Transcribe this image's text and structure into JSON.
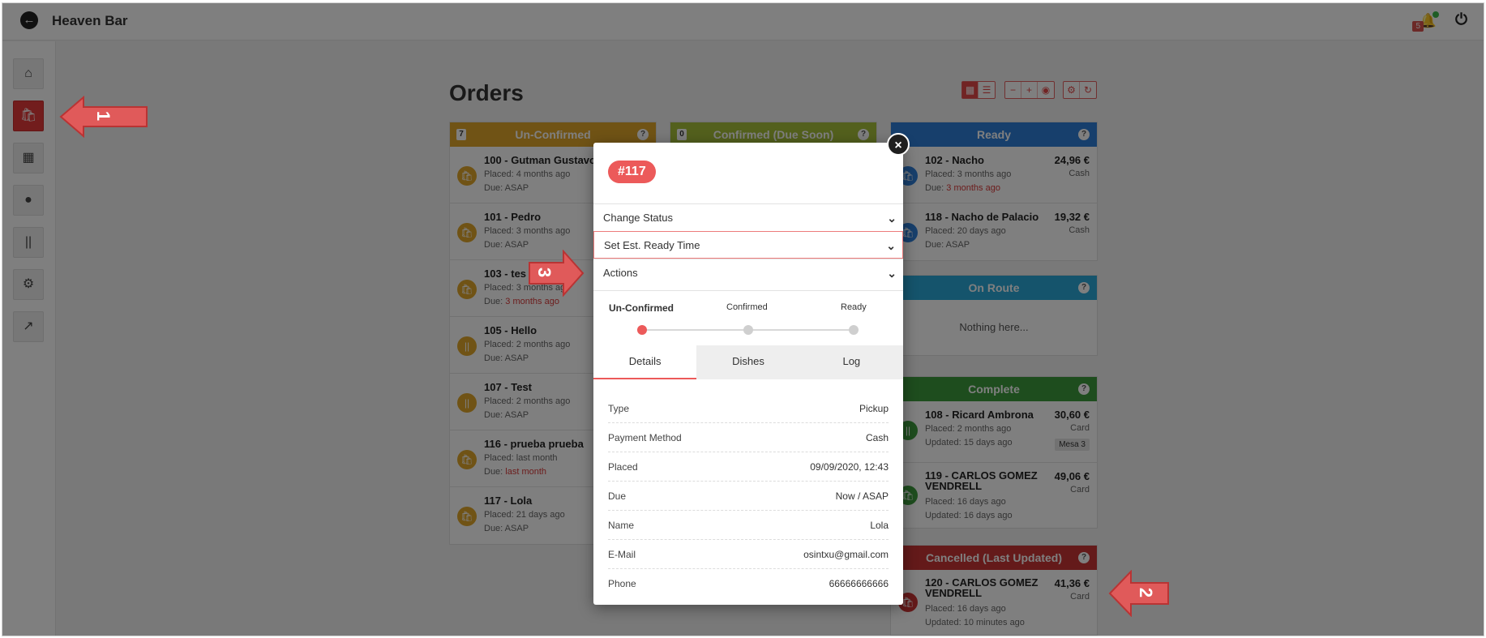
{
  "app": {
    "title": "Heaven Bar",
    "notification_count": "5"
  },
  "page": {
    "title": "Orders"
  },
  "columns": {
    "unconfirmed": {
      "title": "Un-Confirmed",
      "count": "7",
      "color": "#e0a72b",
      "orders": [
        {
          "title": "100 - Gutman Gustavo",
          "placed": "Placed: 4 months ago",
          "due": "Due: ASAP"
        },
        {
          "title": "101 - Pedro",
          "placed": "Placed: 3 months ago",
          "due": "Due: ASAP"
        },
        {
          "title": "103 - tes",
          "placed": "Placed: 3 months ago",
          "due_prefix": "Due: ",
          "due_red": "3 months ago"
        },
        {
          "title": "105 - Hello",
          "placed": "Placed: 2 months ago",
          "due": "Due: ASAP"
        },
        {
          "title": "107 - Test",
          "placed": "Placed: 2 months ago",
          "due": "Due: ASAP"
        },
        {
          "title": "116 - prueba prueba",
          "placed": "Placed: last month",
          "due_prefix": "Due: ",
          "due_red": "last month"
        },
        {
          "title": "117 - Lola",
          "placed": "Placed: 21 days ago",
          "due": "Due: ASAP"
        }
      ]
    },
    "confirmed": {
      "title": "Confirmed (Due Soon)",
      "count": "0",
      "color": "#a6c13a"
    },
    "ready": {
      "title": "Ready",
      "color": "#2f7ed8",
      "orders": [
        {
          "title": "102 - Nacho",
          "placed": "Placed: 3 months ago",
          "due_prefix": "Due: ",
          "due_red": "3 months ago",
          "price": "24,96 €",
          "payment": "Cash"
        },
        {
          "title": "118 - Nacho de Palacio",
          "placed": "Placed: 20 days ago",
          "due": "Due: ASAP",
          "price": "19,32 €",
          "payment": "Cash"
        }
      ]
    },
    "onroute": {
      "title": "On Route",
      "color": "#2aa8d8",
      "empty": "Nothing here..."
    },
    "complete": {
      "title": "Complete",
      "color": "#3d9a3d",
      "orders": [
        {
          "title": "108 - Ricard Ambrona",
          "placed": "Placed: 2 months ago",
          "updated": "Updated: 15 days ago",
          "price": "30,60 €",
          "payment": "Card",
          "tag": "Mesa 3"
        },
        {
          "title": "119 - CARLOS GOMEZ VENDRELL",
          "placed": "Placed: 16 days ago",
          "updated": "Updated: 16 days ago",
          "price": "49,06 €",
          "payment": "Card"
        }
      ]
    },
    "cancelled": {
      "title": "Cancelled (Last Updated)",
      "color": "#c93535",
      "orders": [
        {
          "title": "120 - CARLOS GOMEZ VENDRELL",
          "placed": "Placed: 16 days ago",
          "updated": "Updated: 10 minutes ago",
          "price": "41,36 €",
          "payment": "Card"
        }
      ]
    }
  },
  "modal": {
    "order_number": "#117",
    "close": "×",
    "dropdowns": [
      "Change Status",
      "Set Est. Ready Time",
      "Actions"
    ],
    "steps": [
      "Un-Confirmed",
      "Confirmed",
      "Ready"
    ],
    "tabs": [
      "Details",
      "Dishes",
      "Log"
    ],
    "details": [
      {
        "label": "Type",
        "value": "Pickup"
      },
      {
        "label": "Payment Method",
        "value": "Cash"
      },
      {
        "label": "Placed",
        "value": "09/09/2020, 12:43"
      },
      {
        "label": "Due",
        "value": "Now / ASAP"
      },
      {
        "label": "Name",
        "value": "Lola"
      },
      {
        "label": "E-Mail",
        "value": "osintxu@gmail.com"
      },
      {
        "label": "Phone",
        "value": "66666666666"
      }
    ]
  },
  "annotations": {
    "arrow1": "1",
    "arrow2": "2",
    "arrow3": "3"
  },
  "icons": [
    "back-icon",
    "bell-icon",
    "power-icon",
    "home-icon",
    "bag-icon",
    "calendar-icon",
    "user-icon",
    "cutlery-icon",
    "gear-icon",
    "external-link-icon",
    "chevron-down-icon",
    "close-icon",
    "question-icon"
  ]
}
